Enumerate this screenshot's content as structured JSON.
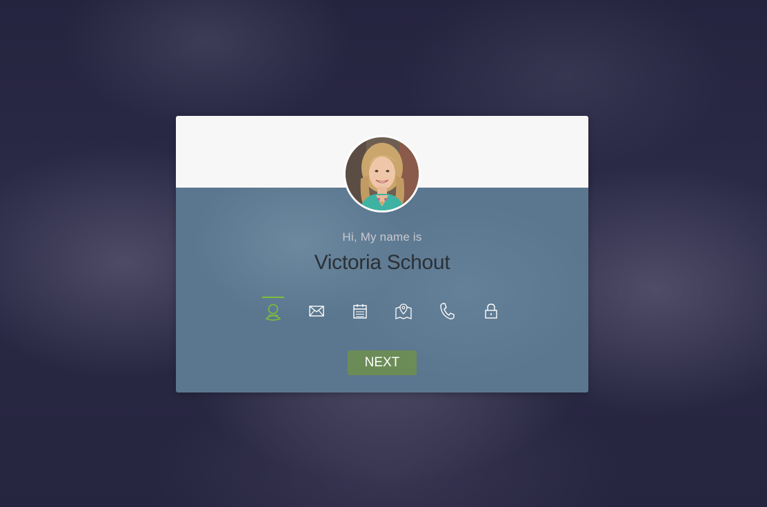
{
  "profile": {
    "greeting": "Hi, My name is",
    "name": "Victoria Schout",
    "avatar_alt": "profile photo"
  },
  "icons": [
    {
      "name": "user-icon",
      "active": true
    },
    {
      "name": "email-icon",
      "active": false
    },
    {
      "name": "calendar-icon",
      "active": false
    },
    {
      "name": "map-icon",
      "active": false
    },
    {
      "name": "phone-icon",
      "active": false
    },
    {
      "name": "lock-icon",
      "active": false
    }
  ],
  "actions": {
    "next_label": "NEXT"
  },
  "colors": {
    "accent": "#7cbf3a",
    "button": "#6c8c57",
    "card_body": "#5b778f",
    "card_top": "#f7f7f7",
    "background": "#22213d"
  }
}
